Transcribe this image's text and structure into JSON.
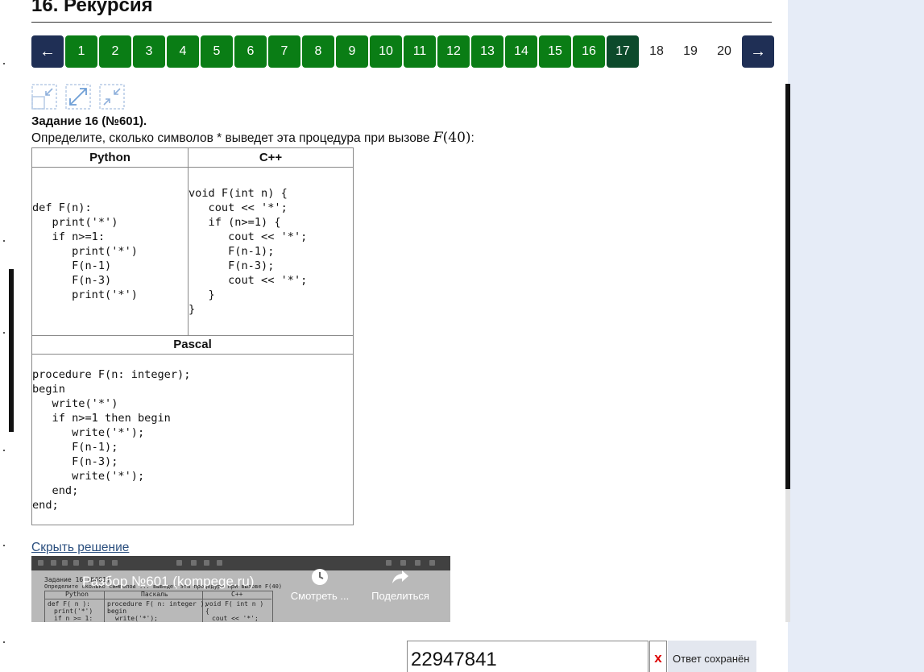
{
  "page": {
    "title": "16. Рекурсия"
  },
  "pagination": {
    "prev_icon": "←",
    "next_icon": "→",
    "pages": [
      "1",
      "2",
      "3",
      "4",
      "5",
      "6",
      "7",
      "8",
      "9",
      "10",
      "11",
      "12",
      "13",
      "14",
      "15",
      "16",
      "17",
      "18",
      "19",
      "20"
    ],
    "done_pages": [
      "1",
      "2",
      "3",
      "4",
      "5",
      "6",
      "7",
      "8",
      "9",
      "10",
      "11",
      "12",
      "13",
      "14",
      "15",
      "16"
    ],
    "current_page": "17"
  },
  "toolbar_icons": [
    "collapse-corner-icon",
    "expand-icon",
    "shrink-icon"
  ],
  "task": {
    "heading": "Задание 16 (№601).",
    "text": "Определите, сколько символов * выведет эта процедура при вызове ",
    "math_func": "F",
    "math_arg": "(40)",
    "math_tail": ":"
  },
  "code_table": {
    "python_header": "Python",
    "cpp_header": "C++",
    "pascal_header": "Pascal",
    "python_code": "def F(n):\n   print('*')\n   if n>=1:\n      print('*')\n      F(n-1)\n      F(n-3)\n      print('*')",
    "cpp_code": "void F(int n) {\n   cout << '*';\n   if (n>=1) {\n      cout << '*';\n      F(n-1);\n      F(n-3);\n      cout << '*';\n   }\n}",
    "pascal_code": "procedure F(n: integer);\nbegin\n   write('*')\n   if n>=1 then begin\n      write('*');\n      F(n-1);\n      F(n-3);\n      write('*');\n   end;\nend;"
  },
  "solution": {
    "toggle_label": "Скрыть решение",
    "video_title": "Разбор №601 (kompege.ru)",
    "watch_label": "Смотреть ...",
    "share_label": "Поделиться",
    "mini_task": "Задание 16 (№601)",
    "mini_prompt": "Определите сколько символов ... выведет эта процедура при вызове F(40)",
    "mini_headers": [
      "Python",
      "Паскаль",
      "C++"
    ],
    "mini_row1": [
      "def F( n ):",
      "procedure F( n: integer );",
      "void F( int n )"
    ],
    "mini_row2": [
      "print('*')",
      "begin",
      "{"
    ],
    "mini_row3": [
      "if n >= 1:",
      "write('*');",
      "cout << '*';"
    ]
  },
  "answer": {
    "value": "22947841",
    "clear_label": "x",
    "status": "Ответ сохранён"
  },
  "colors": {
    "done_page": "#0a7d15",
    "current_page": "#0c4a2b",
    "nav_button": "#1f2f55",
    "link": "#2b4f7e",
    "side_panel": "#e6ecf7"
  }
}
